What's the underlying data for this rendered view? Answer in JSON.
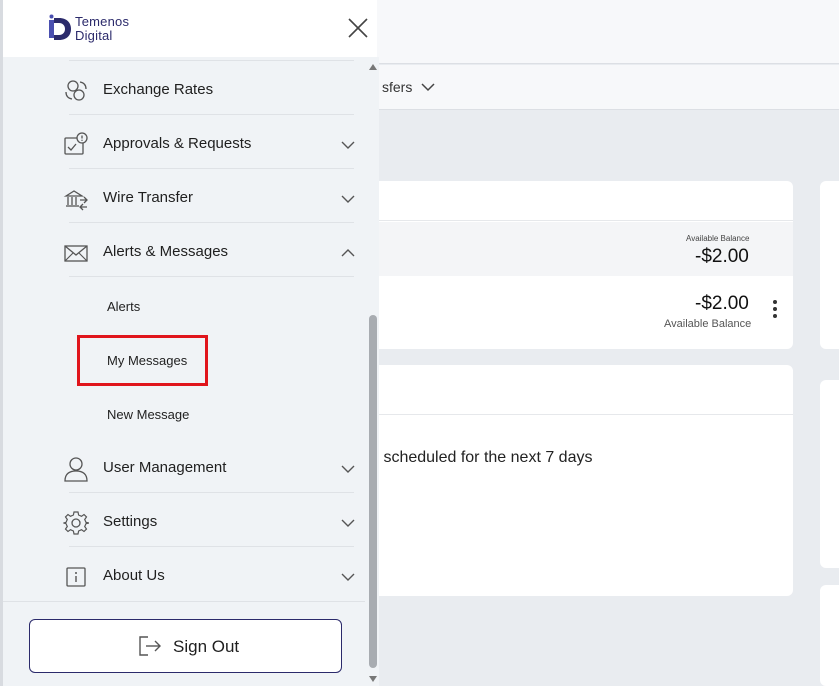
{
  "app": {
    "brand_line1": "Temenos",
    "brand_line2": "Digital"
  },
  "menu": {
    "items": [
      {
        "label": "Exchange Rates",
        "icon": "exchange-rates-icon",
        "expandable": false
      },
      {
        "label": "Approvals & Requests",
        "icon": "approvals-icon",
        "expandable": true
      },
      {
        "label": "Wire Transfer",
        "icon": "wire-transfer-icon",
        "expandable": true
      },
      {
        "label": "Alerts & Messages",
        "icon": "envelope-icon",
        "expandable": true,
        "expanded": true
      },
      {
        "label": "User Management",
        "icon": "user-icon",
        "expandable": true
      },
      {
        "label": "Settings",
        "icon": "gear-icon",
        "expandable": true
      },
      {
        "label": "About Us",
        "icon": "info-icon",
        "expandable": true
      }
    ],
    "alerts_submenu": [
      "Alerts",
      "My Messages",
      "New Message"
    ],
    "highlighted": "My Messages"
  },
  "footer": {
    "signout_label": "Sign Out"
  },
  "background": {
    "nav_partial": "sfers",
    "balance_label_small": "Available Balance",
    "balance_1": "-$2.00",
    "balance_2": "-$2.00",
    "balance_label": "Available Balance",
    "scheduled_text": "s scheduled for the next 7 days"
  },
  "colors": {
    "brand": "#2b2a6b",
    "highlight": "#e0141b",
    "drawer_bg": "#f0f3f6"
  }
}
